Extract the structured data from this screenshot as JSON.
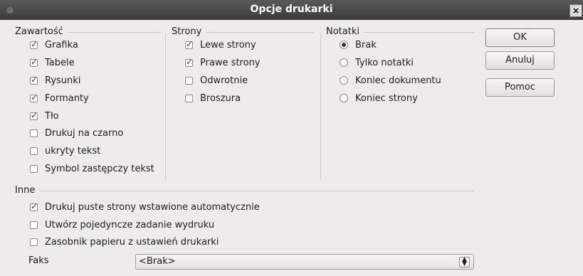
{
  "window": {
    "title": "Opcje drukarki",
    "close_glyph": "×"
  },
  "zawartosc": {
    "label": "Zawartość",
    "items": [
      {
        "label": "Grafika",
        "checked": true
      },
      {
        "label": "Tabele",
        "checked": true
      },
      {
        "label": "Rysunki",
        "checked": true
      },
      {
        "label": "Formanty",
        "checked": true
      },
      {
        "label": "Tło",
        "checked": true
      },
      {
        "label": "Drukuj na czarno",
        "checked": false
      },
      {
        "label": "ukryty tekst",
        "checked": false
      },
      {
        "label": "Symbol zastępczy tekst",
        "checked": false
      }
    ]
  },
  "strony": {
    "label": "Strony",
    "items": [
      {
        "label": "Lewe strony",
        "checked": true
      },
      {
        "label": "Prawe strony",
        "checked": true
      },
      {
        "label": "Odwrotnie",
        "checked": false
      },
      {
        "label": "Broszura",
        "checked": false
      }
    ]
  },
  "notatki": {
    "label": "Notatki",
    "options": [
      {
        "label": "Brak",
        "selected": true
      },
      {
        "label": "Tylko notatki",
        "selected": false
      },
      {
        "label": "Koniec dokumentu",
        "selected": false
      },
      {
        "label": "Koniec strony",
        "selected": false
      }
    ]
  },
  "inne": {
    "label": "Inne",
    "items": [
      {
        "label": "Drukuj puste strony wstawione automatycznie",
        "checked": true
      },
      {
        "label": "Utwórz pojedyncze zadanie wydruku",
        "checked": false
      },
      {
        "label": "Zasobnik papieru z ustawień drukarki",
        "checked": false
      }
    ]
  },
  "faks": {
    "label": "Faks",
    "value": "<Brak>"
  },
  "buttons": {
    "ok": "OK",
    "cancel": "Anuluj",
    "help": "Pomoc"
  }
}
